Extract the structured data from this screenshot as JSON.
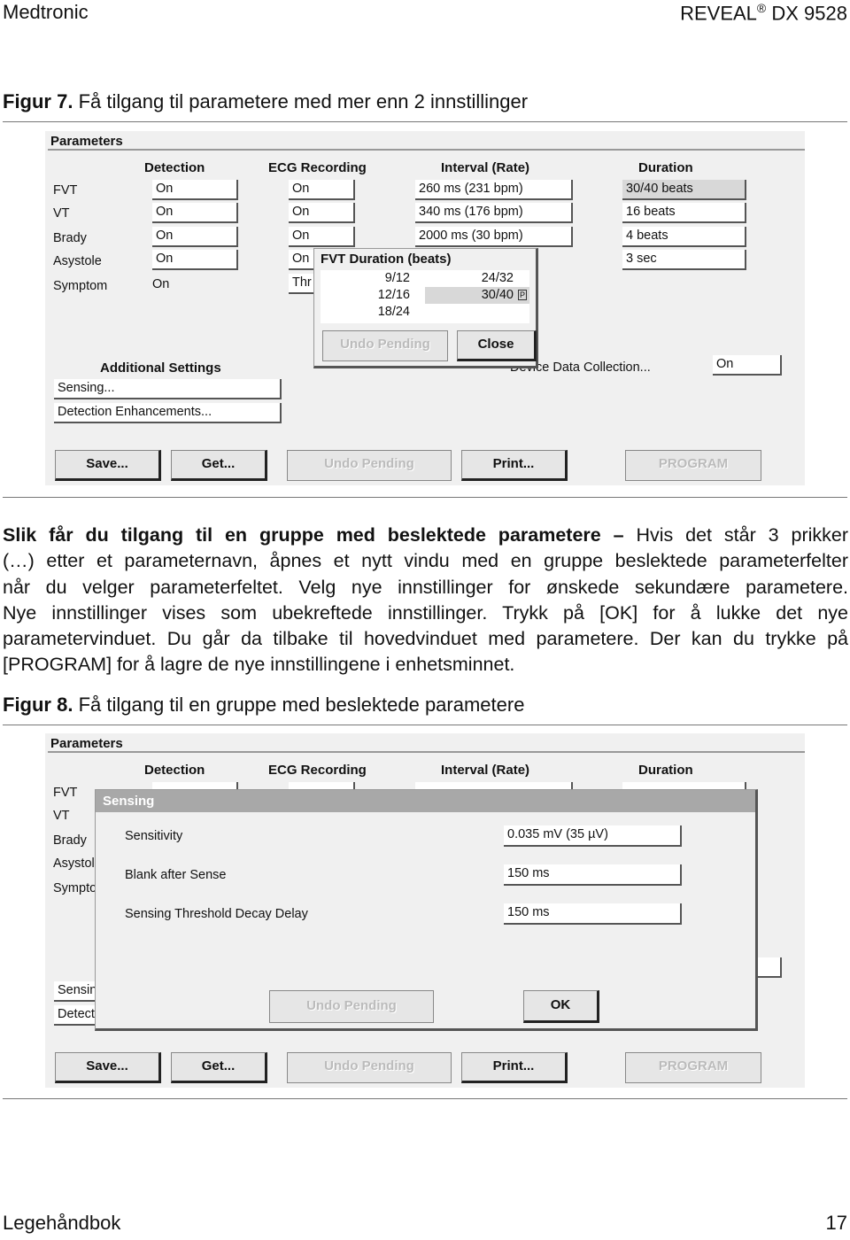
{
  "header": {
    "brand": "Medtronic",
    "product": "REVEAL",
    "registered": "®",
    "model": "DX 9528"
  },
  "figure7": {
    "label": "Figur 7.",
    "title": "Få tilgang til parametere med mer enn 2 innstillinger"
  },
  "parameters": {
    "title": "Parameters",
    "columns": [
      "Detection",
      "ECG Recording",
      "Interval (Rate)",
      "Duration"
    ],
    "rows": [
      {
        "name": "FVT",
        "detection": "On",
        "ecg": "On",
        "interval": "260 ms (231 bpm)",
        "duration": "30/40 beats"
      },
      {
        "name": "VT",
        "detection": "On",
        "ecg": "On",
        "interval": "340 ms (176 bpm)",
        "duration": "16 beats"
      },
      {
        "name": "Brady",
        "detection": "On",
        "ecg": "On",
        "interval": "2000 ms (30 bpm)",
        "duration": "4 beats"
      },
      {
        "name": "Asystole",
        "detection": "On",
        "ecg": "On",
        "interval": "",
        "duration": "3 sec"
      },
      {
        "name": "Symptom",
        "detection": "On",
        "ecg": "Thr"
      }
    ],
    "additional_settings": {
      "title": "Additional Settings",
      "items": [
        "Sensing...",
        "Detection Enhancements..."
      ]
    },
    "device_data_collection": {
      "label": "Device Data Collection...",
      "value": "On"
    },
    "buttons": {
      "save": "Save...",
      "get": "Get...",
      "undo": "Undo Pending",
      "print": "Print...",
      "program": "PROGRAM"
    }
  },
  "fvt_popup": {
    "title": "FVT Duration (beats)",
    "options_col1": [
      "9/12",
      "12/16",
      "18/24"
    ],
    "options_col2": [
      "24/32",
      "30/40"
    ],
    "selected": "30/40",
    "programmed_marker": "P",
    "undo": "Undo Pending",
    "close": "Close"
  },
  "body": {
    "lead": "Slik får du tilgang til en gruppe med beslektede parametere –",
    "lines": [
      " Hvis det står 3 prikker",
      "(…) etter et parameternavn, åpnes et nytt vindu med en gruppe beslektede parameterfelter",
      "når du velger parameterfeltet. Velg nye innstillinger for ønskede sekundære parametere.",
      "Nye innstillinger vises som ubekreftede innstillinger. Trykk på [OK] for å lukke det nye",
      "parametervinduet. Du går da tilbake til hovedvinduet med parametere. Der kan du trykke på",
      "[PROGRAM] for å lagre de nye innstillingene i enhetsminnet."
    ]
  },
  "figure8": {
    "label": "Figur 8.",
    "title": "Få tilgang til en gruppe med beslektede parametere"
  },
  "sensing_dialog": {
    "title": "Sensing",
    "rows": [
      {
        "label": "Sensitivity",
        "value": "0.035 mV (35 µV)"
      },
      {
        "label": "Blank after Sense",
        "value": "150 ms"
      },
      {
        "label": "Sensing Threshold Decay Delay",
        "value": "150 ms"
      }
    ],
    "undo": "Undo Pending",
    "ok": "OK"
  },
  "footer": {
    "manual": "Legehåndbok",
    "page": "17"
  }
}
